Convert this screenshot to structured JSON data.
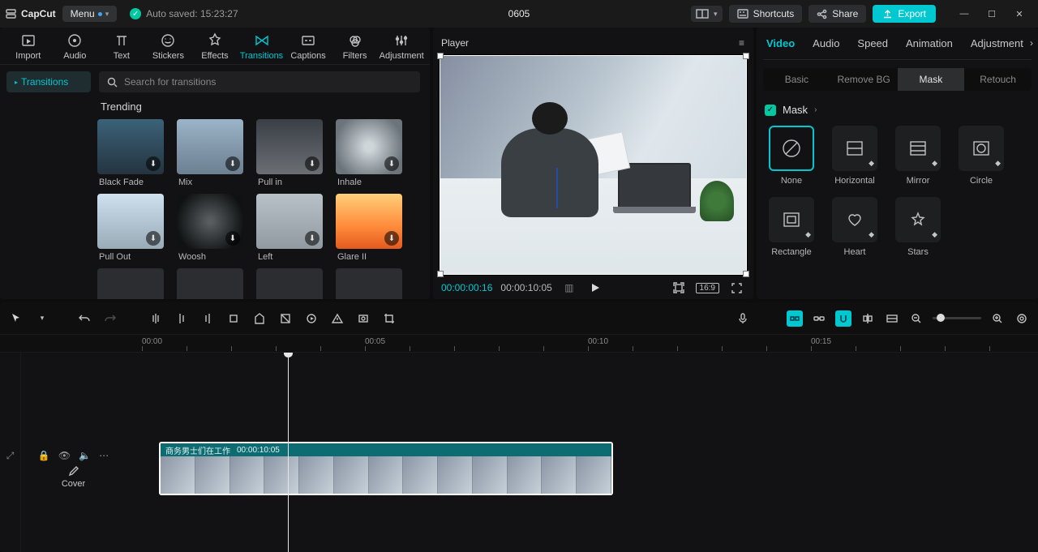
{
  "app": {
    "logo_text": "CapCut"
  },
  "menu": {
    "label": "Menu"
  },
  "auto_saved": {
    "text": "Auto saved: 15:23:27"
  },
  "project": {
    "name": "0605"
  },
  "top_buttons": {
    "layout_icon": "layout-icon",
    "shortcuts": "Shortcuts",
    "share": "Share",
    "export": "Export"
  },
  "tool_tabs": [
    {
      "key": "import",
      "label": "Import"
    },
    {
      "key": "audio",
      "label": "Audio"
    },
    {
      "key": "text",
      "label": "Text"
    },
    {
      "key": "stickers",
      "label": "Stickers"
    },
    {
      "key": "effects",
      "label": "Effects"
    },
    {
      "key": "transitions",
      "label": "Transitions"
    },
    {
      "key": "captions",
      "label": "Captions"
    },
    {
      "key": "filters",
      "label": "Filters"
    },
    {
      "key": "adjustment",
      "label": "Adjustment"
    }
  ],
  "sidebar": {
    "item": "Transitions"
  },
  "search": {
    "placeholder": "Search for transitions"
  },
  "section": {
    "trending": "Trending"
  },
  "transitions": [
    {
      "label": "Black Fade"
    },
    {
      "label": "Mix"
    },
    {
      "label": "Pull in"
    },
    {
      "label": "Inhale"
    },
    {
      "label": "Pull Out"
    },
    {
      "label": "Woosh"
    },
    {
      "label": "Left"
    },
    {
      "label": "Glare II"
    }
  ],
  "player": {
    "title": "Player",
    "current": "00:00:00:16",
    "duration": "00:00:10:05",
    "ratio": "16:9"
  },
  "inspector": {
    "tabs": [
      "Video",
      "Audio",
      "Speed",
      "Animation",
      "Adjustment"
    ],
    "subtabs": [
      "Basic",
      "Remove BG",
      "Mask",
      "Retouch"
    ],
    "mask_label": "Mask",
    "masks": [
      {
        "label": "None"
      },
      {
        "label": "Horizontal"
      },
      {
        "label": "Mirror"
      },
      {
        "label": "Circle"
      },
      {
        "label": "Rectangle"
      },
      {
        "label": "Heart"
      },
      {
        "label": "Stars"
      }
    ]
  },
  "timeline": {
    "ticks": [
      "00:00",
      "00:05",
      "00:10",
      "00:15"
    ],
    "clip_title": "商务男士们在工作",
    "clip_duration": "00:00:10:05",
    "cover": "Cover"
  }
}
